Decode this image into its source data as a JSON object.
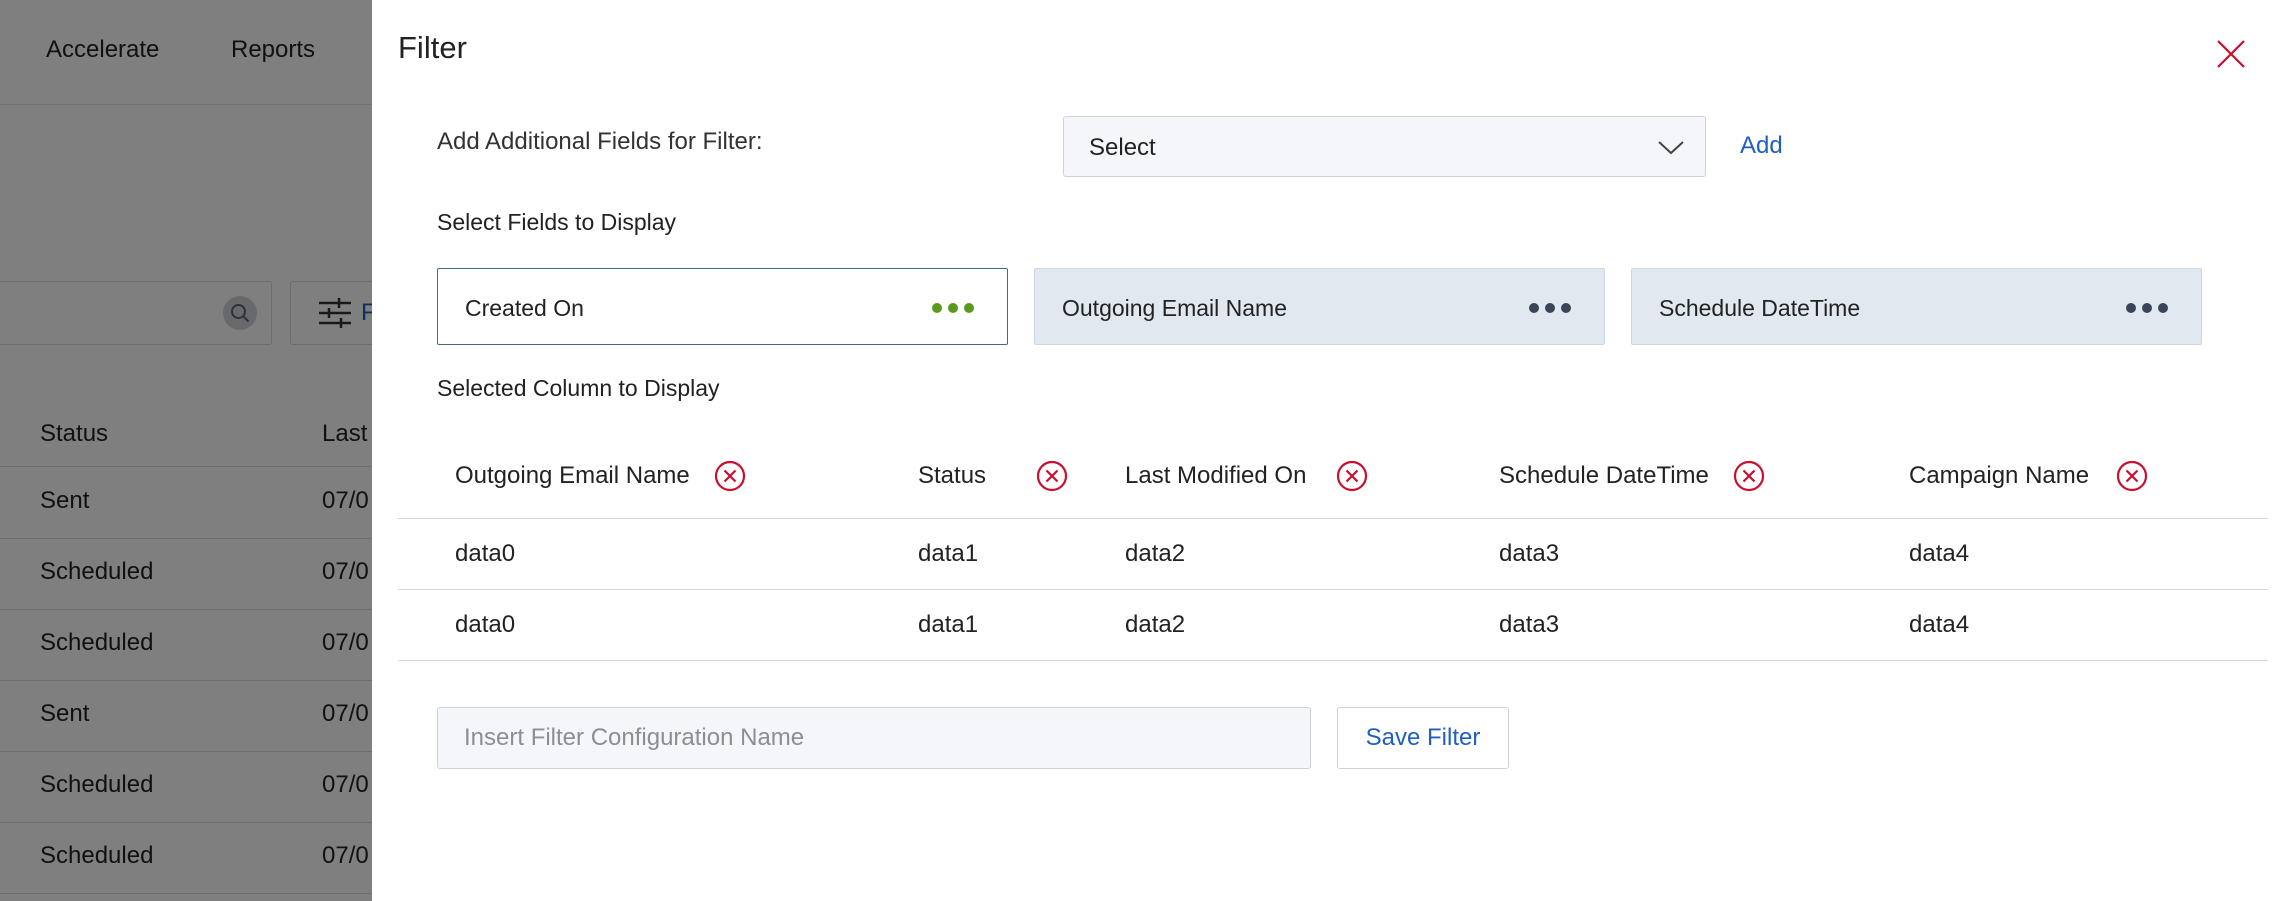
{
  "background": {
    "nav": [
      "Accelerate",
      "Reports"
    ],
    "filter_button_label": "F",
    "table_headers": [
      "Status",
      "Last"
    ],
    "rows": [
      {
        "status": "Sent",
        "last": "07/0"
      },
      {
        "status": "Scheduled",
        "last": "07/0"
      },
      {
        "status": "Scheduled",
        "last": "07/0"
      },
      {
        "status": "Sent",
        "last": "07/0"
      },
      {
        "status": "Scheduled",
        "last": "07/0"
      },
      {
        "status": "Scheduled",
        "last": "07/0"
      }
    ]
  },
  "panel": {
    "title": "Filter",
    "close_icon": "close-icon",
    "add_fields_label": "Add Additional Fields for Filter:",
    "select_value": "Select",
    "add_label": "Add",
    "fields_label": "Select Fields to Display",
    "fields": [
      {
        "name": "Created On",
        "selected": true
      },
      {
        "name": "Outgoing Email Name",
        "selected": false
      },
      {
        "name": "Schedule DateTime",
        "selected": false
      }
    ],
    "selected_columns_label": "Selected Column to Display",
    "columns": [
      "Outgoing Email Name",
      "Status",
      "Last Modified On",
      "Schedule DateTime",
      "Campaign Name"
    ],
    "rows": [
      [
        "data0",
        "data1",
        "data2",
        "data3",
        "data4"
      ],
      [
        "data0",
        "data1",
        "data2",
        "data3",
        "data4"
      ]
    ],
    "config_name_placeholder": "Insert Filter Configuration Name",
    "config_name_value": "",
    "save_label": "Save Filter"
  },
  "colors": {
    "accent": "#1f5fbf",
    "remove_icon": "#c8102e",
    "selected_dots": "#5a9a1a",
    "unselected_dots": "#3a4656",
    "overlay": "rgba(0,0,0,0.5)"
  }
}
